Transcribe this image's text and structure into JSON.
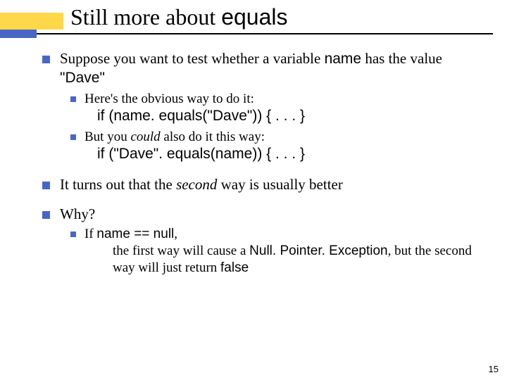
{
  "title": {
    "pre": "Still more about ",
    "code": "equals"
  },
  "p1": {
    "a": "Suppose you want to test whether a variable ",
    "name": "name",
    "b": " has the value ",
    "dave": "\"Dave\""
  },
  "s1": {
    "text": "Here's the obvious way to do it:",
    "code": "if (name. equals(\"Dave\")) { . . . }"
  },
  "s2": {
    "a": "But you ",
    "could": "could",
    "b": " also do it this way:",
    "code": "if (\"Dave\". equals(name)) { . . . }"
  },
  "p2": {
    "a": "It turns out that the ",
    "second": "second",
    "b": " way is usually better"
  },
  "p3": "Why?",
  "s3": {
    "a": "If ",
    "cond": "name == null",
    "b": ",",
    "line2a": "the first way will cause a ",
    "npe": "Null. Pointer. Exception",
    "line2b": ", but the second way will just return ",
    "false": "false"
  },
  "pageNumber": "15"
}
